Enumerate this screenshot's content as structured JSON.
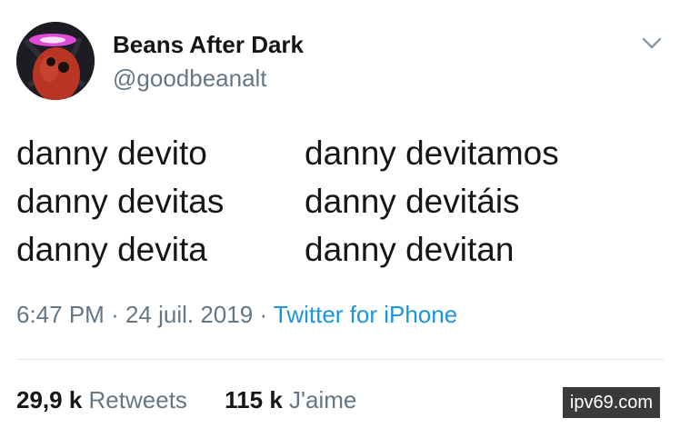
{
  "author": {
    "display_name": "Beans After Dark",
    "handle": "@goodbeanalt"
  },
  "tweet": {
    "lines": [
      [
        "danny devito",
        "danny devitamos"
      ],
      [
        "danny devitas",
        "danny devitáis"
      ],
      [
        "danny devita",
        "danny devitan"
      ]
    ],
    "time": "6:47 PM",
    "date": "24 juil. 2019",
    "separator": "·",
    "source": "Twitter for iPhone"
  },
  "stats": {
    "retweets_count": "29,9 k",
    "retweets_label": "Retweets",
    "likes_count": "115 k",
    "likes_label": "J'aime"
  },
  "watermark": "ipv69.com",
  "icons": {
    "menu": "chevron-down-icon",
    "avatar": "bean-avatar"
  },
  "colors": {
    "text": "#14171a",
    "secondary": "#657786",
    "link": "#1b95e0",
    "divider": "#e1e8ed"
  }
}
